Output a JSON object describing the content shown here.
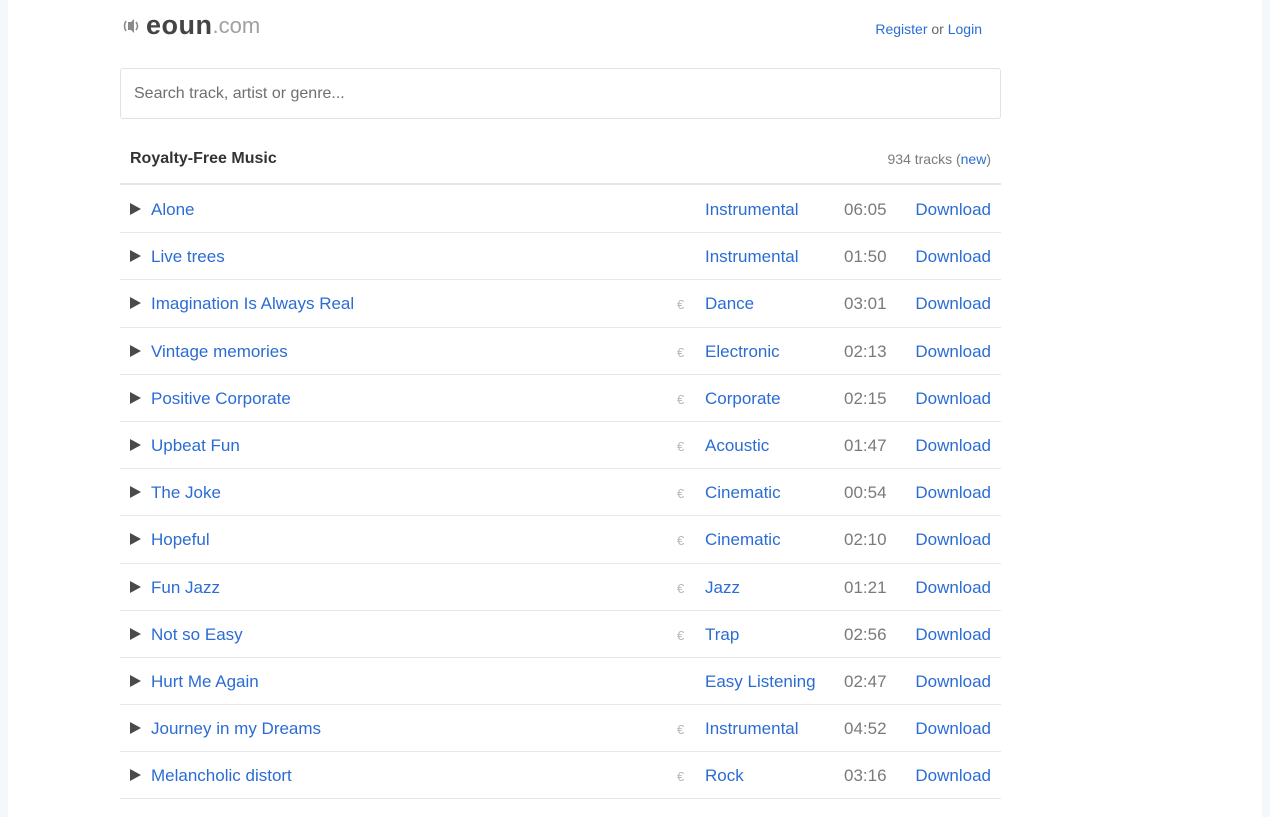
{
  "header": {
    "logo_icon": "speaker-sound-icon",
    "logo_name": "eoun",
    "logo_tld": ".com",
    "register_label": "Register",
    "or_label": " or ",
    "login_label": "Login"
  },
  "search": {
    "placeholder": "Search track, artist or genre..."
  },
  "list": {
    "title": "Royalty-Free Music",
    "count_text": "934 tracks (",
    "new_label": "new",
    "count_close": ")"
  },
  "tracks": [
    {
      "title": "Alone",
      "euro": "",
      "genre": "Instrumental",
      "duration": "06:05",
      "download": "Download"
    },
    {
      "title": "Live trees",
      "euro": "",
      "genre": "Instrumental",
      "duration": "01:50",
      "download": "Download"
    },
    {
      "title": "Imagination Is Always Real",
      "euro": "€",
      "genre": "Dance",
      "duration": "03:01",
      "download": "Download"
    },
    {
      "title": "Vintage memories",
      "euro": "€",
      "genre": "Electronic",
      "duration": "02:13",
      "download": "Download"
    },
    {
      "title": "Positive Corporate",
      "euro": "€",
      "genre": "Corporate",
      "duration": "02:15",
      "download": "Download"
    },
    {
      "title": "Upbeat Fun",
      "euro": "€",
      "genre": "Acoustic",
      "duration": "01:47",
      "download": "Download"
    },
    {
      "title": "The Joke",
      "euro": "€",
      "genre": "Cinematic",
      "duration": "00:54",
      "download": "Download"
    },
    {
      "title": "Hopeful",
      "euro": "€",
      "genre": "Cinematic",
      "duration": "02:10",
      "download": "Download"
    },
    {
      "title": "Fun Jazz",
      "euro": "€",
      "genre": "Jazz",
      "duration": "01:21",
      "download": "Download"
    },
    {
      "title": "Not so Easy",
      "euro": "€",
      "genre": "Trap",
      "duration": "02:56",
      "download": "Download"
    },
    {
      "title": "Hurt Me Again",
      "euro": "",
      "genre": "Easy Listening",
      "duration": "02:47",
      "download": "Download"
    },
    {
      "title": "Journey in my Dreams",
      "euro": "€",
      "genre": "Instrumental",
      "duration": "04:52",
      "download": "Download"
    },
    {
      "title": "Melancholic distort",
      "euro": "€",
      "genre": "Rock",
      "duration": "03:16",
      "download": "Download"
    }
  ],
  "colors": {
    "link": "#2b6cd4",
    "muted": "#7a7a7a",
    "text": "#333333"
  }
}
